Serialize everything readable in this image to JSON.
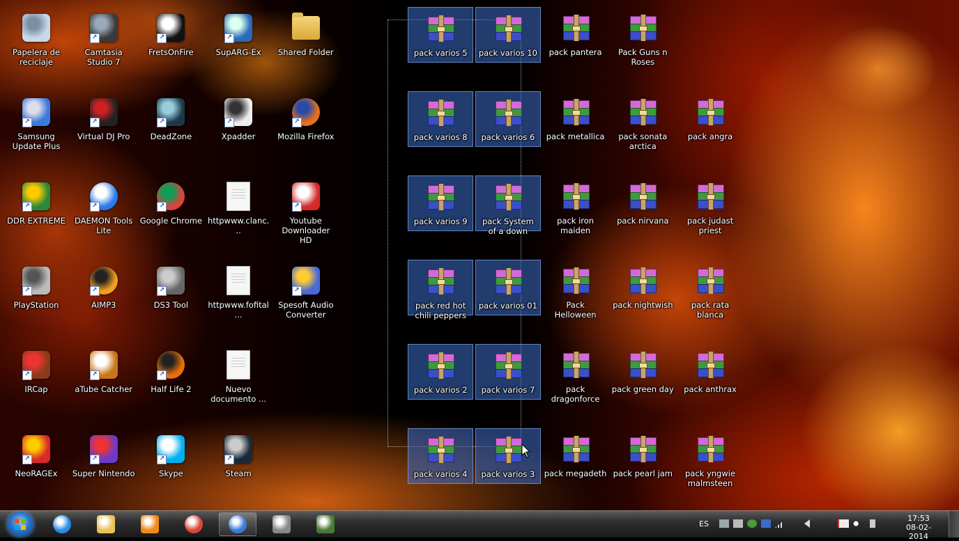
{
  "desktop_icons": [
    {
      "label": "Papelera de reciclaje",
      "icon": "recycle-bin-icon",
      "col": 0,
      "row": 0,
      "type": "bin"
    },
    {
      "label": "Camtasia Studio 7",
      "icon": "camtasia-icon",
      "col": 1,
      "row": 0,
      "type": "app"
    },
    {
      "label": "FretsOnFire",
      "icon": "fretsonfire-icon",
      "col": 2,
      "row": 0,
      "type": "app"
    },
    {
      "label": "SupARG-Ex",
      "icon": "suparg-icon",
      "col": 3,
      "row": 0,
      "type": "app"
    },
    {
      "label": "Shared Folder",
      "icon": "folder-icon",
      "col": 4,
      "row": 0,
      "type": "folder"
    },
    {
      "label": "Samsung Update Plus",
      "icon": "samsung-update-icon",
      "col": 0,
      "row": 1,
      "type": "app"
    },
    {
      "label": "Virtual DJ Pro",
      "icon": "virtual-dj-icon",
      "col": 1,
      "row": 1,
      "type": "app"
    },
    {
      "label": "DeadZone",
      "icon": "deadzone-icon",
      "col": 2,
      "row": 1,
      "type": "app"
    },
    {
      "label": "Xpadder",
      "icon": "xpadder-icon",
      "col": 3,
      "row": 1,
      "type": "app"
    },
    {
      "label": "Mozilla Firefox",
      "icon": "firefox-icon",
      "col": 4,
      "row": 1,
      "type": "app"
    },
    {
      "label": "DDR EXTREME",
      "icon": "ddr-icon",
      "col": 0,
      "row": 2,
      "type": "app"
    },
    {
      "label": "DAEMON Tools Lite",
      "icon": "daemon-tools-icon",
      "col": 1,
      "row": 2,
      "type": "app"
    },
    {
      "label": "Google Chrome",
      "icon": "chrome-icon",
      "col": 2,
      "row": 2,
      "type": "app"
    },
    {
      "label": "httpwww.clanc...",
      "icon": "document-icon",
      "col": 3,
      "row": 2,
      "type": "doc"
    },
    {
      "label": "Youtube Downloader HD",
      "icon": "youtube-downloader-icon",
      "col": 4,
      "row": 2,
      "type": "app"
    },
    {
      "label": "PlayStation",
      "icon": "playstation-icon",
      "col": 0,
      "row": 3,
      "type": "app"
    },
    {
      "label": "AIMP3",
      "icon": "aimp-icon",
      "col": 1,
      "row": 3,
      "type": "app"
    },
    {
      "label": "DS3 Tool",
      "icon": "gamepad-icon",
      "col": 2,
      "row": 3,
      "type": "app"
    },
    {
      "label": "httpwww.fofital...",
      "icon": "document-icon",
      "col": 3,
      "row": 3,
      "type": "doc"
    },
    {
      "label": "Spesoft Audio Converter",
      "icon": "audio-converter-icon",
      "col": 4,
      "row": 3,
      "type": "app"
    },
    {
      "label": "IRCap",
      "icon": "ircap-icon",
      "col": 0,
      "row": 4,
      "type": "app"
    },
    {
      "label": "aTube Catcher",
      "icon": "atube-catcher-icon",
      "col": 1,
      "row": 4,
      "type": "app"
    },
    {
      "label": "Half Life 2",
      "icon": "half-life-icon",
      "col": 2,
      "row": 4,
      "type": "app"
    },
    {
      "label": "Nuevo documento ...",
      "icon": "document-icon",
      "col": 3,
      "row": 4,
      "type": "doc"
    },
    {
      "label": "NeoRAGEx",
      "icon": "neoragex-icon",
      "col": 0,
      "row": 5,
      "type": "app"
    },
    {
      "label": "Super Nintendo",
      "icon": "zsnes-icon",
      "col": 1,
      "row": 5,
      "type": "app"
    },
    {
      "label": "Skype",
      "icon": "skype-icon",
      "col": 2,
      "row": 5,
      "type": "app"
    },
    {
      "label": "Steam",
      "icon": "steam-icon",
      "col": 3,
      "row": 5,
      "type": "app"
    },
    {
      "label": "pack varios 5",
      "icon": "winrar-archive-icon",
      "col": 6,
      "row": 0,
      "type": "rar",
      "selected": true
    },
    {
      "label": "pack varios 10",
      "icon": "winrar-archive-icon",
      "col": 7,
      "row": 0,
      "type": "rar",
      "selected": true
    },
    {
      "label": "pack pantera",
      "icon": "winrar-archive-icon",
      "col": 8,
      "row": 0,
      "type": "rar"
    },
    {
      "label": "Pack Guns n Roses",
      "icon": "winrar-archive-icon",
      "col": 9,
      "row": 0,
      "type": "rar"
    },
    {
      "label": "pack varios 8",
      "icon": "winrar-archive-icon",
      "col": 6,
      "row": 1,
      "type": "rar",
      "selected": true
    },
    {
      "label": "pack varios 6",
      "icon": "winrar-archive-icon",
      "col": 7,
      "row": 1,
      "type": "rar",
      "selected": true
    },
    {
      "label": "pack metallica",
      "icon": "winrar-archive-icon",
      "col": 8,
      "row": 1,
      "type": "rar"
    },
    {
      "label": "pack sonata arctica",
      "icon": "winrar-archive-icon",
      "col": 9,
      "row": 1,
      "type": "rar"
    },
    {
      "label": "pack angra",
      "icon": "winrar-archive-icon",
      "col": 10,
      "row": 1,
      "type": "rar"
    },
    {
      "label": "pack varios 9",
      "icon": "winrar-archive-icon",
      "col": 6,
      "row": 2,
      "type": "rar",
      "selected": true
    },
    {
      "label": "pack System of a down",
      "icon": "winrar-archive-icon",
      "col": 7,
      "row": 2,
      "type": "rar",
      "selected": true
    },
    {
      "label": "pack iron maiden",
      "icon": "winrar-archive-icon",
      "col": 8,
      "row": 2,
      "type": "rar"
    },
    {
      "label": "pack nirvana",
      "icon": "winrar-archive-icon",
      "col": 9,
      "row": 2,
      "type": "rar"
    },
    {
      "label": "pack judast priest",
      "icon": "winrar-archive-icon",
      "col": 10,
      "row": 2,
      "type": "rar"
    },
    {
      "label": "pack red hot chili peppers",
      "icon": "winrar-archive-icon",
      "col": 6,
      "row": 3,
      "type": "rar",
      "selected": true
    },
    {
      "label": "pack varios 01",
      "icon": "winrar-archive-icon",
      "col": 7,
      "row": 3,
      "type": "rar",
      "selected": true
    },
    {
      "label": "Pack Helloween",
      "icon": "winrar-archive-icon",
      "col": 8,
      "row": 3,
      "type": "rar"
    },
    {
      "label": "pack nightwish",
      "icon": "winrar-archive-icon",
      "col": 9,
      "row": 3,
      "type": "rar"
    },
    {
      "label": "pack rata blanca",
      "icon": "winrar-archive-icon",
      "col": 10,
      "row": 3,
      "type": "rar"
    },
    {
      "label": "pack varios 2",
      "icon": "winrar-archive-icon",
      "col": 6,
      "row": 4,
      "type": "rar",
      "selected": true
    },
    {
      "label": "pack varios 7",
      "icon": "winrar-archive-icon",
      "col": 7,
      "row": 4,
      "type": "rar",
      "selected": true
    },
    {
      "label": "pack dragonforce",
      "icon": "winrar-archive-icon",
      "col": 8,
      "row": 4,
      "type": "rar"
    },
    {
      "label": "pack green day",
      "icon": "winrar-archive-icon",
      "col": 9,
      "row": 4,
      "type": "rar"
    },
    {
      "label": "pack anthrax",
      "icon": "winrar-archive-icon",
      "col": 10,
      "row": 4,
      "type": "rar"
    },
    {
      "label": "pack varios 4",
      "icon": "winrar-archive-icon",
      "col": 6,
      "row": 5,
      "type": "rar",
      "selected": true
    },
    {
      "label": "pack varios 3",
      "icon": "winrar-archive-icon",
      "col": 7,
      "row": 5,
      "type": "rar",
      "selected": true
    },
    {
      "label": "pack megadeth",
      "icon": "winrar-archive-icon",
      "col": 8,
      "row": 5,
      "type": "rar"
    },
    {
      "label": "pack pearl jam",
      "icon": "winrar-archive-icon",
      "col": 9,
      "row": 5,
      "type": "rar"
    },
    {
      "label": "pack yngwie malmsteen",
      "icon": "winrar-archive-icon",
      "col": 10,
      "row": 5,
      "type": "rar"
    }
  ],
  "taskbar": {
    "pinned": [
      {
        "icon": "internet-explorer-icon"
      },
      {
        "icon": "file-explorer-icon"
      },
      {
        "icon": "media-player-icon"
      },
      {
        "icon": "chrome-icon"
      },
      {
        "icon": "camtasia-recorder-icon",
        "active": true
      },
      {
        "icon": "gamepad-app-icon"
      },
      {
        "icon": "camera-app-icon"
      }
    ],
    "tray": {
      "language": "ES",
      "time": "17:53",
      "date": "08-02-2014"
    }
  },
  "colors": {
    "selection": "#3c6ec8",
    "taskbar": "#2e2e2e",
    "label_text": "#ffffff"
  }
}
